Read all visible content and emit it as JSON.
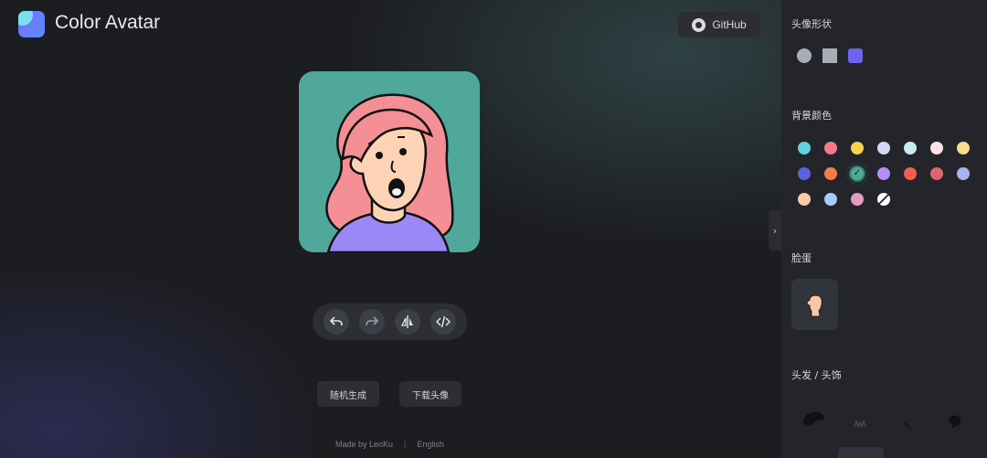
{
  "header": {
    "title": "Color Avatar",
    "github_label": "GitHub"
  },
  "actions": {
    "undo_icon": "undo-icon",
    "redo_icon": "redo-icon",
    "flip_icon": "flip-icon",
    "code_icon": "code-icon"
  },
  "buttons": {
    "random_label": "随机生成",
    "download_label": "下载头像"
  },
  "footer": {
    "made_by": "Made by LeoKu",
    "separator": "|",
    "language": "English"
  },
  "avatar": {
    "background_color": "#4fa89a",
    "hair_color": "#f58f96",
    "skin_color": "#fcd3b5",
    "shirt_color": "#9b87f5"
  },
  "sidebar": {
    "shape_title": "头像形状",
    "shapes": [
      {
        "name": "circle",
        "color": "#a8aeb6"
      },
      {
        "name": "square",
        "color": "#a8aeb6"
      },
      {
        "name": "squircle",
        "color": "#6d63f2"
      }
    ],
    "bg_title": "背景颜色",
    "bg_colors": [
      "#5fd3de",
      "#f47a8a",
      "#f5d250",
      "#d5d6f6",
      "#c8ecef",
      "#fbe2e6",
      "#f6dc8c",
      "#5b63e0",
      "#f77b45",
      "#4fa89a",
      "#b58ef7",
      "#f05e4f",
      "#e0646f",
      "#a7b4ee",
      "#fccaa7",
      "#a6cdf8",
      "#e79bc2",
      "#f0f0f0"
    ],
    "bg_selected_index": 9,
    "face_title": "脸蛋",
    "hair_title": "头发 / 头饰"
  }
}
